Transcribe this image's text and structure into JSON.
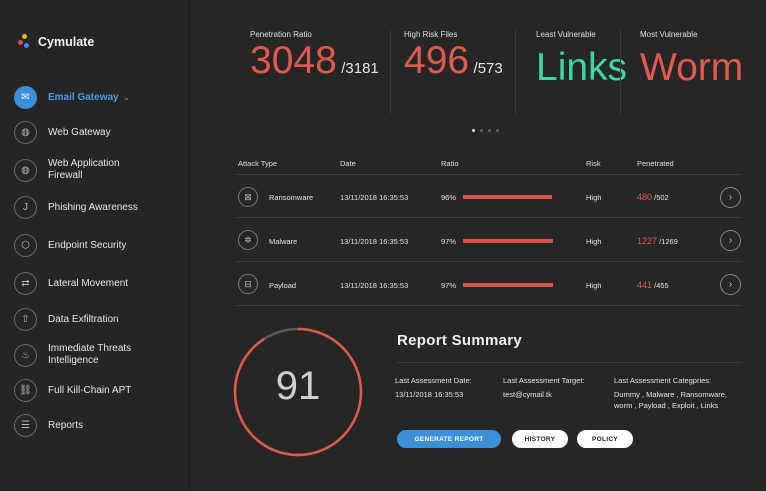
{
  "app": {
    "name": "Cymulate"
  },
  "sidebar": {
    "items": [
      {
        "label": "Email Gateway",
        "icon": "mail-icon",
        "active": true
      },
      {
        "label": "Web Gateway",
        "icon": "globe-icon"
      },
      {
        "label": "Web Application\nFirewall",
        "icon": "globe-icon"
      },
      {
        "label": "Phishing Awareness",
        "icon": "hook-icon"
      },
      {
        "label": "Endpoint Security",
        "icon": "shield-icon"
      },
      {
        "label": "Lateral Movement",
        "icon": "arrows-icon"
      },
      {
        "label": "Data Exfiltration",
        "icon": "upload-icon"
      },
      {
        "label": "Immediate Threats\nIntelligence",
        "icon": "flame-icon"
      },
      {
        "label": "Full Kill-Chain APT",
        "icon": "chain-icon"
      },
      {
        "label": "Reports",
        "icon": "report-icon"
      }
    ]
  },
  "stats": [
    {
      "label": "Penetration Ratio",
      "value": "3048",
      "total": "/3181"
    },
    {
      "label": "High Risk Files",
      "value": "496",
      "total": "/573"
    },
    {
      "label": "Least Vulnerable",
      "value": "Links",
      "color": "#3fd6a0"
    },
    {
      "label": "Most Vulnerable",
      "value": "Worm",
      "color": "#e05a4f"
    }
  ],
  "carousel": {
    "pages": 4,
    "active": 0
  },
  "table": {
    "headers": {
      "attack_type": "Attack Type",
      "date": "Date",
      "ratio": "Ratio",
      "risk": "Risk",
      "penetrated": "Penetrated"
    },
    "rows": [
      {
        "type": "Ransomware",
        "icon": "ransomware-icon",
        "date": "13/11/2018 16:35:53",
        "ratio": "96%",
        "ratio_value": 0.96,
        "risk": "High",
        "pen": "480",
        "pen_total": "/502"
      },
      {
        "type": "Malware",
        "icon": "bug-icon",
        "date": "13/11/2018 16:35:53",
        "ratio": "97%",
        "ratio_value": 0.97,
        "risk": "High",
        "pen": "1227",
        "pen_total": "/1269"
      },
      {
        "type": "Payload",
        "icon": "briefcase-icon",
        "date": "13/11/2018 16:35:53",
        "ratio": "97%",
        "ratio_value": 0.97,
        "risk": "High",
        "pen": "441",
        "pen_total": "/455"
      }
    ]
  },
  "score": {
    "value": "91",
    "fraction": 0.91,
    "color": "#e05a4f"
  },
  "report": {
    "title": "Report Summary",
    "date_label": "Last Assessment Date:",
    "date_value": "13/11/2018 16:35:53",
    "target_label": "Last Assessment Target:",
    "target_value": "test@cymail.tk",
    "categories_label": "Last Assessment Categpries:",
    "categories_line1": "Dummy , Malware , Ransomware,",
    "categories_line2": "worm , Payload , Exploit , Links"
  },
  "buttons": {
    "generate": "GENERATE REPORT",
    "history": "HISTORY",
    "policy": "POLICY"
  },
  "colors": {
    "accent": "#3d8fd8",
    "danger": "#e05a4f",
    "success": "#3fd6a0"
  }
}
